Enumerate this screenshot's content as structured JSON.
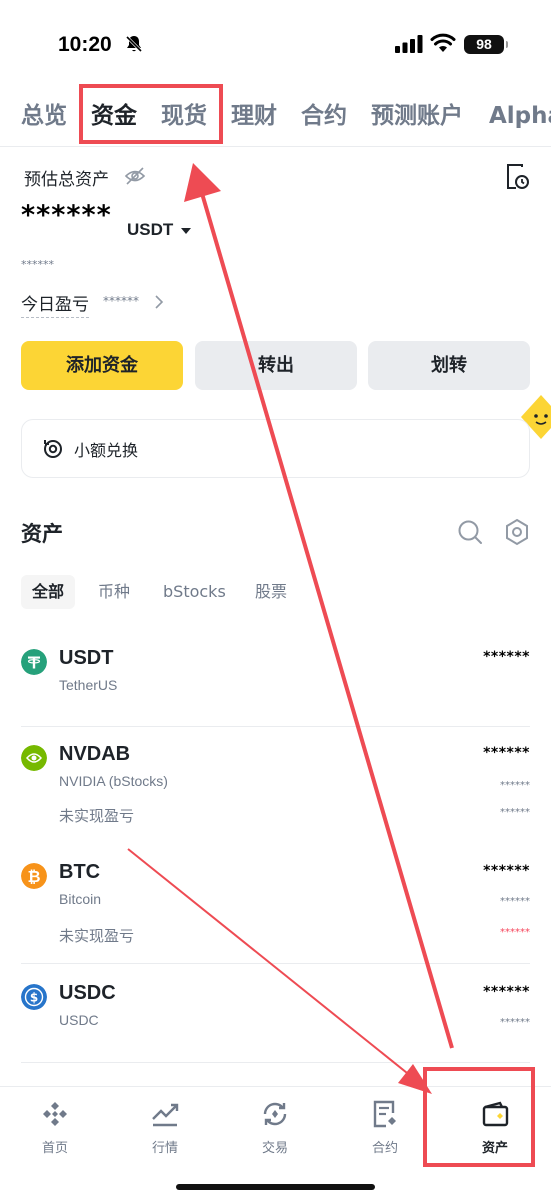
{
  "status_bar": {
    "time": "10:20",
    "battery": "98"
  },
  "top_tabs": [
    {
      "label": "总览"
    },
    {
      "label": "资金"
    },
    {
      "label": "现货"
    },
    {
      "label": "理财"
    },
    {
      "label": "合约"
    },
    {
      "label": "预测账户"
    },
    {
      "label": "Alpha"
    }
  ],
  "overview": {
    "estimated_label": "预估总资产",
    "balance": "******",
    "unit": "USDT",
    "sub_value": "******",
    "pnl_label": "今日盈亏",
    "pnl_value": "******"
  },
  "actions": {
    "add_funds": "添加资金",
    "withdraw": "转出",
    "transfer": "划转"
  },
  "convert": {
    "label": "小额兑换"
  },
  "assets": {
    "title": "资产",
    "filters": [
      "全部",
      "币种",
      "bStocks",
      "股票"
    ],
    "unrealized_label": "未实现盈亏",
    "rows": [
      {
        "symbol": "USDT",
        "name": "TetherUS",
        "amount": "******"
      },
      {
        "symbol": "NVDAB",
        "name": "NVIDIA (bStocks)",
        "amount": "******",
        "value": "******",
        "pnl": "******"
      },
      {
        "symbol": "BTC",
        "name": "Bitcoin",
        "amount": "******",
        "value": "******",
        "pnl": "******"
      },
      {
        "symbol": "USDC",
        "name": "USDC",
        "amount": "******",
        "value": "******"
      }
    ]
  },
  "bottom_nav": [
    "首页",
    "行情",
    "交易",
    "合约",
    "资产"
  ],
  "colors": {
    "accent": "#fcd535",
    "annotation": "#ee4b53",
    "loss": "#f6465d"
  },
  "icons": [
    "bell-slash-icon",
    "signal-icon",
    "wifi-icon",
    "eye-off-icon",
    "history-icon",
    "chevron-right-icon",
    "convert-icon",
    "search-icon",
    "settings-icon",
    "home-icon",
    "markets-icon",
    "trade-icon",
    "futures-icon",
    "wallet-icon"
  ]
}
